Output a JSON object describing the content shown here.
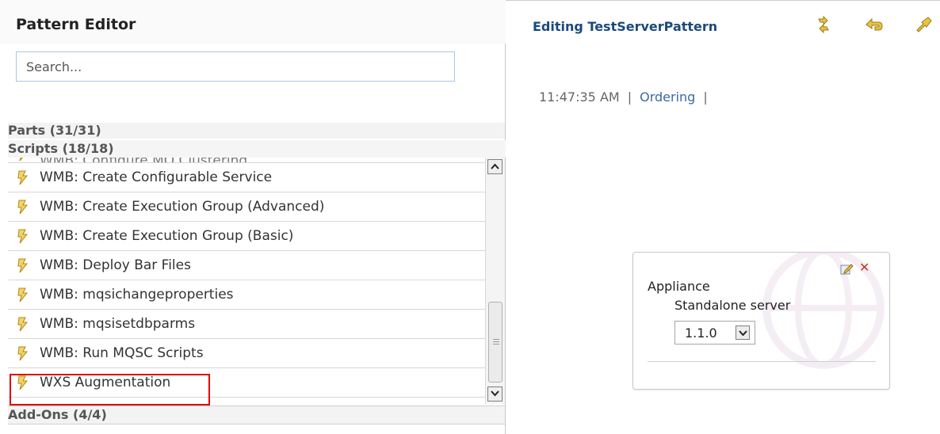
{
  "left_panel": {
    "title": "Pattern Editor",
    "search_placeholder": "Search...",
    "sections": {
      "parts": "Parts (31/31)",
      "scripts": "Scripts (18/18)",
      "addons": "Add-Ons (4/4)"
    },
    "scripts": [
      {
        "label": "WMB: Configure MQ Clustering",
        "icon": "script-icon"
      },
      {
        "label": "WMB: Create Configurable Service",
        "icon": "script-icon"
      },
      {
        "label": "WMB: Create Execution Group (Advanced)",
        "icon": "script-icon"
      },
      {
        "label": "WMB: Create Execution Group (Basic)",
        "icon": "script-icon"
      },
      {
        "label": "WMB: Deploy Bar Files",
        "icon": "script-icon"
      },
      {
        "label": "WMB: mqsichangeproperties",
        "icon": "script-icon"
      },
      {
        "label": "WMB: mqsisetdbparms",
        "icon": "script-icon"
      },
      {
        "label": "WMB: Run MQSC Scripts",
        "icon": "script-icon"
      },
      {
        "label": "WXS Augmentation",
        "icon": "script-icon"
      }
    ]
  },
  "right_panel": {
    "editing_title": "Editing TestServerPattern",
    "toolbar_icons": [
      "refresh-icon",
      "undo-icon",
      "layout-icon"
    ],
    "status": {
      "time": "11:47:35 AM",
      "sep1": "|",
      "link": "Ordering",
      "sep2": "|"
    },
    "part_card": {
      "title": "Appliance",
      "subtitle": "Standalone server",
      "version": "1.1.0"
    }
  },
  "colors": {
    "highlight": "#e00000",
    "title_blue": "#1a4a7d",
    "link_blue": "#3a6aa0"
  }
}
